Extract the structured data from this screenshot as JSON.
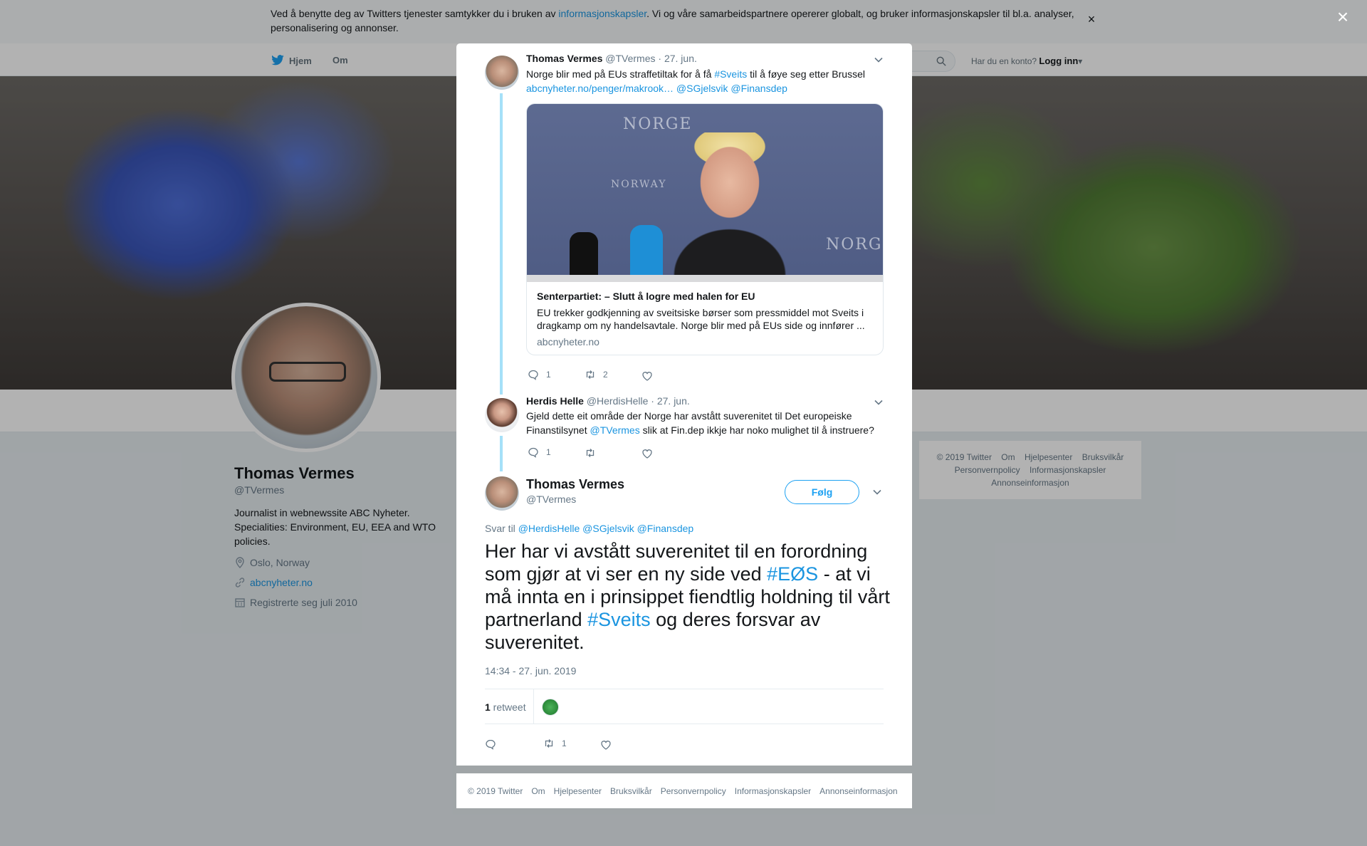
{
  "cookie_banner": {
    "text_before": "Ved å benytte deg av Twitters tjenester samtykker du i bruken av ",
    "link": "informasjonskapsler",
    "text_after": ". Vi og våre samarbeidspartnere opererer globalt, og bruker informasjonskapsler til bl.a. analyser, personalisering og annonser.",
    "close": "×"
  },
  "nav": {
    "home": "Hjem",
    "about": "Om",
    "have_account": "Har du en konto?",
    "login": "Logg inn"
  },
  "profile": {
    "name": "Thomas Vermes",
    "handle": "@TVermes",
    "bio": "Journalist in webnewssite ABC Nyheter. Specialities: Environment, EU, EEA and WTO policies.",
    "location": "Oslo, Norway",
    "website": "abcnyheter.no",
    "joined": "Registrerte seg juli 2010"
  },
  "side_footer": {
    "links_row1": [
      "© 2019 Twitter",
      "Om",
      "Hjelpesenter",
      "Bruksvilkår"
    ],
    "links_row2": [
      "Personvernpolicy",
      "Informasjonskapsler"
    ],
    "links_row3": [
      "Annonseinformasjon"
    ]
  },
  "modal_close": "×",
  "tweet1": {
    "name": "Thomas Vermes",
    "handle": "@TVermes",
    "date": "· 27. jun.",
    "text_before": "Norge blir med på EUs straffetiltak for å få ",
    "hashtag": "#Sveits",
    "text_after": " til å føye seg etter Brussel",
    "link": "abcnyheter.no/penger/makrook…",
    "mention1": "@SGjelsvik",
    "mention2": "@Finansdep",
    "card": {
      "image_watermarks": [
        "NORGE",
        "NORWAY",
        "NORGE"
      ],
      "title": "Senterpartiet: – Slutt å logre med halen for EU",
      "description": "EU trekker godkjenning av sveitsiske børser som pressmiddel mot Sveits i dragkamp om ny handelsavtale. Norge blir med på EUs side og innfører ...",
      "domain": "abcnyheter.no"
    },
    "replies": "1",
    "retweets": "2"
  },
  "tweet2": {
    "name": "Herdis Helle",
    "handle": "@HerdisHelle",
    "date": "· 27. jun.",
    "text_before": "Gjeld dette eit område der Norge har avstått suverenitet til Det europeiske Finanstilsynet ",
    "mention": "@TVermes",
    "text_after": " slik at Fin.dep ikkje har noko mulighet til å instruere?",
    "replies": "1"
  },
  "main_tweet": {
    "name": "Thomas Vermes",
    "handle": "@TVermes",
    "follow": "Følg",
    "reply_to_label": "Svar til ",
    "reply_to_mentions": "@HerdisHelle @SGjelsvik @Finansdep",
    "text_part1": "Her har vi avstått suverenitet til en forordning som gjør at vi ser en ny side ved ",
    "hashtag1": "#EØS",
    "text_part2": " - at vi må innta en i prinsippet fiendtlig holdning til vårt partnerland ",
    "hashtag2": "#Sveits",
    "text_part3": " og deres forsvar av suverenitet.",
    "timestamp": "14:34 - 27. jun. 2019",
    "retweet_count": "1",
    "retweet_label": " retweet",
    "action_retweets": "1"
  },
  "modal_footer": [
    "© 2019 Twitter",
    "Om",
    "Hjelpesenter",
    "Bruksvilkår",
    "Personvernpolicy",
    "Informasjonskapsler",
    "Annonseinformasjon"
  ],
  "colors": {
    "link": "#1b95e0",
    "follow": "#1da1f2",
    "thread": "#a5e0f8"
  }
}
